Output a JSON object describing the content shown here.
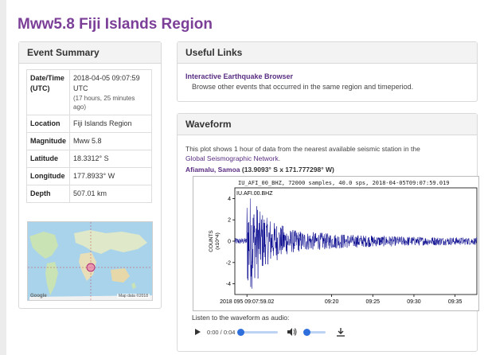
{
  "page": {
    "title": "Mww5.8 Fiji Islands Region"
  },
  "summary": {
    "heading": "Event Summary",
    "rows": [
      {
        "key": "Date/Time (UTC)",
        "value": "2018-04-05 09:07:59 UTC",
        "extra": "(17 hours, 25 minutes ago)"
      },
      {
        "key": "Location",
        "value": "Fiji Islands Region"
      },
      {
        "key": "Magnitude",
        "value": "Mww 5.8"
      },
      {
        "key": "Latitude",
        "value": "18.3312° S"
      },
      {
        "key": "Longitude",
        "value": "177.8933° W"
      },
      {
        "key": "Depth",
        "value": "507.01 km"
      }
    ],
    "map": {
      "google_label": "Google",
      "data_label": "Map data ©2018"
    }
  },
  "links": {
    "heading": "Useful Links",
    "items": [
      {
        "label": "Interactive Earthquake Browser",
        "description": "Browse other events that occurred in the same region and timeperiod."
      }
    ]
  },
  "waveform": {
    "heading": "Waveform",
    "intro": "This plot shows 1 hour of data from the nearest available seismic station in the",
    "network_link": "Global Seismographic Network",
    "network_suffix": ".",
    "station_name": "Afiamalu, Samoa",
    "station_coords": "(13.9093° S x 171.777298° W)",
    "plot": {
      "title": "IU_AFI_00_BHZ, 72000 samples, 40.0 sps, 2018-04-05T09:07:59.019",
      "trace_label": "IU.AFI.00.BHZ",
      "ylabel": "COUNTS",
      "yunits": "(x10^4)"
    },
    "audio": {
      "label": "Listen to the waveform as audio:",
      "time": "0:00 / 0:04"
    }
  },
  "colors": {
    "accent": "#7b3f98",
    "link": "#5a2d82",
    "trace": "#00008b"
  },
  "chart_data": {
    "type": "line",
    "title": "IU_AFI_00_BHZ, 72000 samples, 40.0 sps, 2018-04-05T09:07:59.019",
    "ylabel": "COUNTS (x10^4)",
    "xlabel": "",
    "x_ticks": [
      "2018 095 09:07:59.02",
      "09:20",
      "09:25",
      "09:30",
      "09:35"
    ],
    "y_ticks": [
      4,
      2,
      0,
      -2,
      -4
    ],
    "ylim": [
      -5,
      5
    ],
    "grid": false,
    "series": [
      {
        "name": "IU.AFI.00.BHZ",
        "envelope": [
          0.3,
          0.3,
          4.5,
          3.6,
          2.8,
          2.2,
          1.8,
          1.5,
          1.3,
          1.1,
          1.0,
          0.9,
          0.85,
          0.8,
          0.8,
          0.75,
          0.7,
          0.7,
          0.65,
          0.6,
          0.6,
          0.55,
          0.55,
          0.5,
          0.5,
          0.5,
          0.45,
          0.45,
          0.45,
          0.42,
          0.42,
          0.4,
          0.4,
          0.4,
          0.38,
          0.38,
          0.36,
          0.36,
          0.35,
          0.35
        ]
      }
    ]
  }
}
